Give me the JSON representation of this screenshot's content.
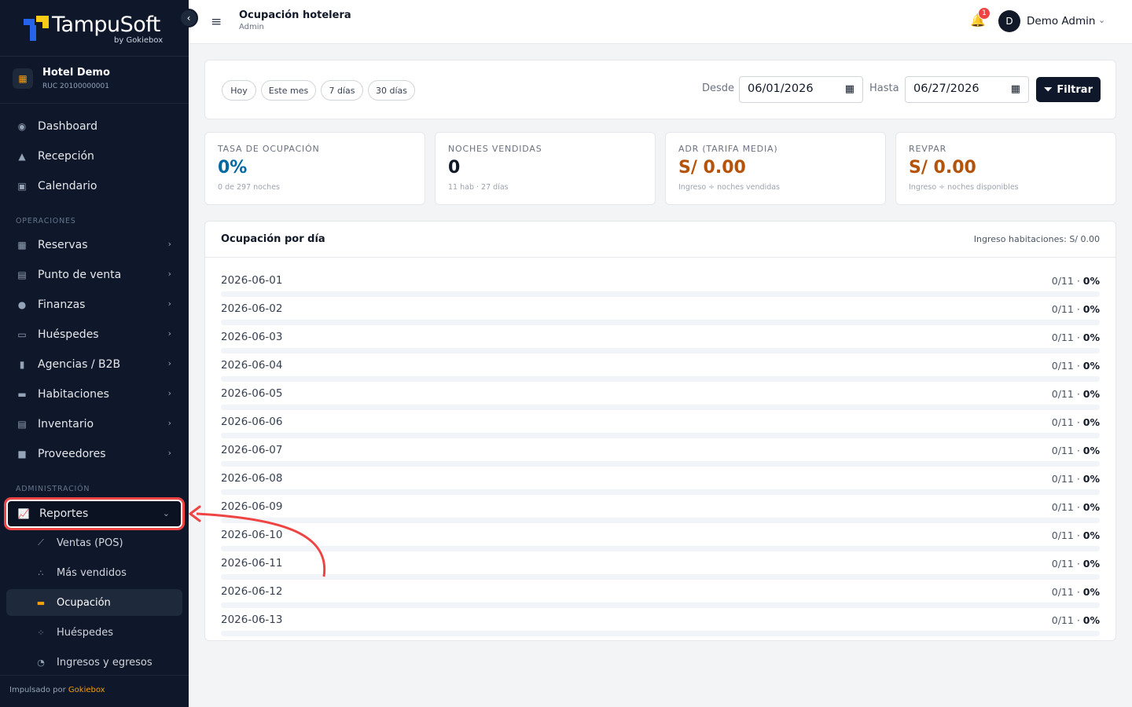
{
  "brand": {
    "name": "TampuSoft",
    "sub": "by Gokiebox"
  },
  "hotel": {
    "name": "Hotel Demo",
    "ruc": "RUC 20100000001"
  },
  "nav": {
    "dashboard": "Dashboard",
    "recepcion": "Recepción",
    "calendario": "Calendario",
    "section_operaciones": "OPERACIONES",
    "reservas": "Reservas",
    "punto_venta": "Punto de venta",
    "finanzas": "Finanzas",
    "huespedes": "Huéspedes",
    "agencias": "Agencias / B2B",
    "habitaciones": "Habitaciones",
    "inventario": "Inventario",
    "proveedores": "Proveedores",
    "section_admin": "ADMINISTRACIÓN",
    "reportes": "Reportes",
    "sub": {
      "ventas": "Ventas (POS)",
      "mas_vendidos": "Más vendidos",
      "ocupacion": "Ocupación",
      "huespedes": "Huéspedes",
      "ingresos": "Ingresos y egresos"
    }
  },
  "footer": {
    "prefix": "Impulsado por",
    "brand": "Gokiebox"
  },
  "topbar": {
    "title": "Ocupación hotelera",
    "subtitle": "Admin",
    "notifications": "1",
    "avatar_initial": "D",
    "user": "Demo Admin"
  },
  "filters": {
    "chips": [
      "Hoy",
      "Este mes",
      "7 días",
      "30 días"
    ],
    "desde_label": "Desde",
    "desde_value": "06/01/2026",
    "hasta_label": "Hasta",
    "hasta_value": "06/27/2026",
    "button": "Filtrar"
  },
  "kpis": [
    {
      "label": "TASA DE OCUPACIÓN",
      "value": "0%",
      "note": "0 de 297 noches",
      "color": "#0369a1"
    },
    {
      "label": "NOCHES VENDIDAS",
      "value": "0",
      "note": "11 hab · 27 días",
      "color": "#111827"
    },
    {
      "label": "ADR (TARIFA MEDIA)",
      "value": "S/ 0.00",
      "note": "Ingreso ÷ noches vendidas",
      "color": "#b45309"
    },
    {
      "label": "REVPAR",
      "value": "S/ 0.00",
      "note": "Ingreso ÷ noches disponibles",
      "color": "#b45309"
    }
  ],
  "occupancy": {
    "title": "Ocupación por día",
    "income": "Ingreso habitaciones: S/ 0.00",
    "rows": [
      {
        "date": "2026-06-01",
        "ratio": "0/11",
        "pct": "0%",
        "fill": 0
      },
      {
        "date": "2026-06-02",
        "ratio": "0/11",
        "pct": "0%",
        "fill": 0
      },
      {
        "date": "2026-06-03",
        "ratio": "0/11",
        "pct": "0%",
        "fill": 0
      },
      {
        "date": "2026-06-04",
        "ratio": "0/11",
        "pct": "0%",
        "fill": 0
      },
      {
        "date": "2026-06-05",
        "ratio": "0/11",
        "pct": "0%",
        "fill": 0
      },
      {
        "date": "2026-06-06",
        "ratio": "0/11",
        "pct": "0%",
        "fill": 0
      },
      {
        "date": "2026-06-07",
        "ratio": "0/11",
        "pct": "0%",
        "fill": 0
      },
      {
        "date": "2026-06-08",
        "ratio": "0/11",
        "pct": "0%",
        "fill": 0
      },
      {
        "date": "2026-06-09",
        "ratio": "0/11",
        "pct": "0%",
        "fill": 0
      },
      {
        "date": "2026-06-10",
        "ratio": "0/11",
        "pct": "0%",
        "fill": 0
      },
      {
        "date": "2026-06-11",
        "ratio": "0/11",
        "pct": "0%",
        "fill": 0
      },
      {
        "date": "2026-06-12",
        "ratio": "0/11",
        "pct": "0%",
        "fill": 0
      },
      {
        "date": "2026-06-13",
        "ratio": "0/11",
        "pct": "0%",
        "fill": 0
      }
    ]
  },
  "colors": {
    "sidebar": "#0f172a",
    "accent": "#f59e0b",
    "annotation": "#ef4444"
  }
}
